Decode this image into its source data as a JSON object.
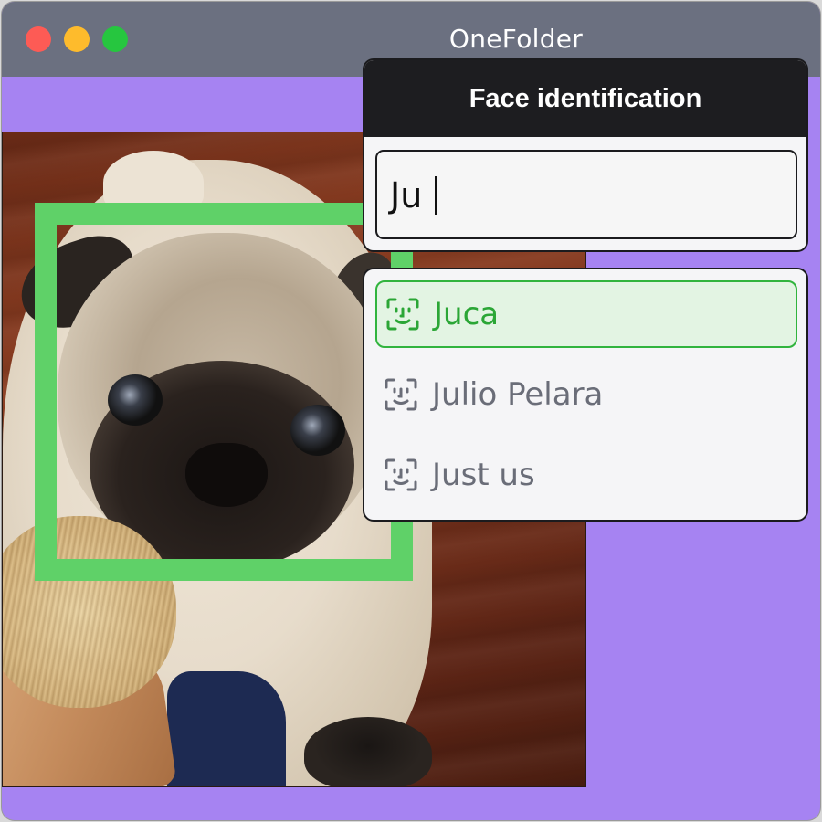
{
  "window": {
    "title": "OneFolder",
    "controls": [
      "close",
      "minimize",
      "maximize"
    ]
  },
  "colors": {
    "background": "#a683f2",
    "titlebar": "#6b7080",
    "face_box": "#5fd168",
    "active_item": "#2ba636"
  },
  "face_dialog": {
    "title": "Face identification",
    "input_value": "Ju"
  },
  "suggestions": [
    {
      "label": "Juca",
      "icon": "face-id-icon",
      "selected": true
    },
    {
      "label": "Julio Pelara",
      "icon": "face-id-icon",
      "selected": false
    },
    {
      "label": "Just us",
      "icon": "face-id-icon",
      "selected": false
    }
  ]
}
